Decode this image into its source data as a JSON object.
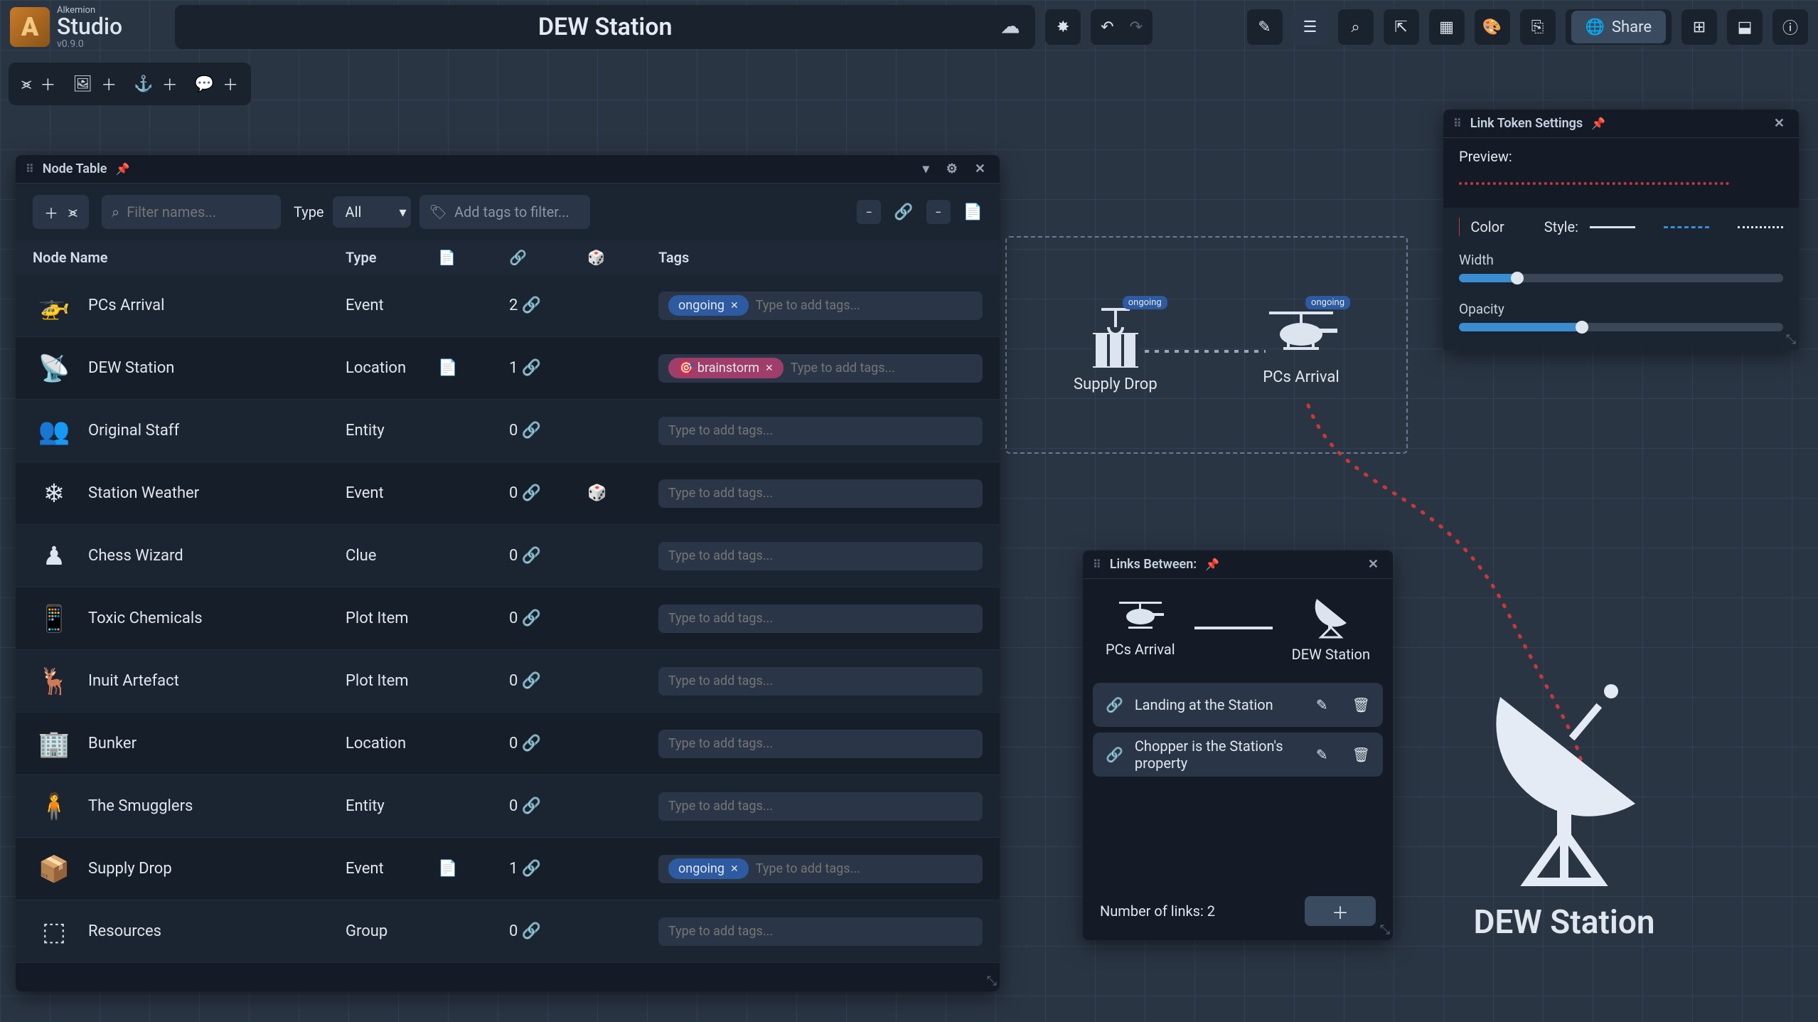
{
  "app": {
    "brand": "Alkemion",
    "studio": "Studio",
    "version": "v0.9.0"
  },
  "title": "DEW Station",
  "toolbar": {
    "share_label": "Share"
  },
  "node_table": {
    "title": "Node Table",
    "filter_placeholder": "Filter names...",
    "type_label": "Type",
    "type_value": "All",
    "tags_placeholder": "Add tags to filter...",
    "columns": {
      "name": "Node Name",
      "type": "Type",
      "tags": "Tags"
    },
    "tag_input_placeholder": "Type to add tags...",
    "rows": [
      {
        "name": "PCs Arrival",
        "type": "Event",
        "has_file": false,
        "links": 2,
        "dice": false,
        "tags": [
          {
            "label": "ongoing",
            "color": "blue"
          }
        ]
      },
      {
        "name": "DEW Station",
        "type": "Location",
        "has_file": true,
        "links": 1,
        "dice": false,
        "tags": [
          {
            "label": "brainstorm",
            "color": "pink"
          }
        ]
      },
      {
        "name": "Original Staff",
        "type": "Entity",
        "has_file": false,
        "links": 0,
        "dice": false,
        "tags": []
      },
      {
        "name": "Station Weather",
        "type": "Event",
        "has_file": false,
        "links": 0,
        "dice": true,
        "tags": []
      },
      {
        "name": "Chess Wizard",
        "type": "Clue",
        "has_file": false,
        "links": 0,
        "dice": false,
        "tags": []
      },
      {
        "name": "Toxic Chemicals",
        "type": "Plot Item",
        "has_file": false,
        "links": 0,
        "dice": false,
        "tags": []
      },
      {
        "name": "Inuit Artefact",
        "type": "Plot Item",
        "has_file": false,
        "links": 0,
        "dice": false,
        "tags": []
      },
      {
        "name": "Bunker",
        "type": "Location",
        "has_file": false,
        "links": 0,
        "dice": false,
        "tags": []
      },
      {
        "name": "The Smugglers",
        "type": "Entity",
        "has_file": false,
        "links": 0,
        "dice": false,
        "tags": []
      },
      {
        "name": "Supply Drop",
        "type": "Event",
        "has_file": true,
        "links": 1,
        "dice": false,
        "tags": [
          {
            "label": "ongoing",
            "color": "blue"
          }
        ]
      },
      {
        "name": "Resources",
        "type": "Group",
        "has_file": false,
        "links": 0,
        "dice": false,
        "tags": []
      }
    ]
  },
  "canvas": {
    "tokens": [
      {
        "name": "Supply Drop",
        "badge": "ongoing"
      },
      {
        "name": "PCs Arrival",
        "badge": "ongoing"
      }
    ],
    "big_label": "DEW Station"
  },
  "links_panel": {
    "title": "Links Between:",
    "nodeA": "PCs Arrival",
    "nodeB": "DEW Station",
    "items": [
      {
        "label": "Landing at the Station"
      },
      {
        "label": "Chopper is the Station's property"
      }
    ],
    "count_label": "Number of links:",
    "count": "2"
  },
  "settings_panel": {
    "title": "Link Token Settings",
    "preview_label": "Preview:",
    "color_label": "Color",
    "color": "#c73838",
    "style_label": "Style:",
    "width_label": "Width",
    "width_pct": 18,
    "opacity_label": "Opacity",
    "opacity_pct": 38
  }
}
